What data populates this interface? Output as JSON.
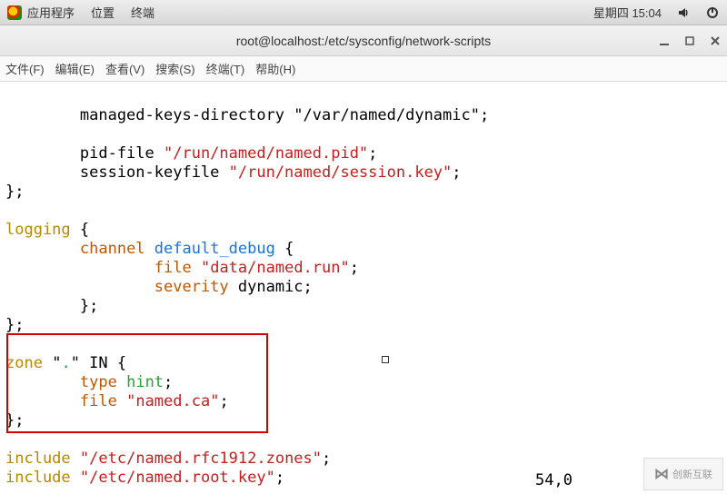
{
  "panel": {
    "apps": "应用程序",
    "places": "位置",
    "terminal_menu": "终端",
    "datetime": "星期四 15:04"
  },
  "window": {
    "title": "root@localhost:/etc/sysconfig/network-scripts"
  },
  "menubar": {
    "file": "文件(F)",
    "edit": "编辑(E)",
    "view": "查看(V)",
    "search": "搜索(S)",
    "terminal": "终端(T)",
    "help": "帮助(H)"
  },
  "code": {
    "line1": "        managed-keys-directory \"/var/named/dynamic\";",
    "blank": "",
    "line3a": "        pid-file ",
    "line3s": "\"/run/named/named.pid\"",
    "line3b": ";",
    "line4a": "        session-keyfile ",
    "line4s": "\"/run/named/session.key\"",
    "line4b": ";",
    "line5": "};",
    "log_kw": "logging",
    "log_rest": " {",
    "chan_kw": "channel",
    "chan_sp": "        ",
    "chan_id": "default_debug",
    "chan_rest": " {",
    "file_sp": "                ",
    "file_kw": "file",
    "file_s": "\"data/named.run\"",
    "file_end": ";",
    "sev_sp": "                ",
    "sev_kw": "severity",
    "sev_rest": " dynamic;",
    "close_inner": "        };",
    "close_outer": "};",
    "zone_kw": "zone",
    "zone_q1": " \"",
    "zone_dot": ".",
    "zone_q2": "\" IN {",
    "type_sp": "        ",
    "type_kw": "type",
    "type_sp2": " ",
    "type_hint": "hint",
    "type_end": ";",
    "zfile_sp": "        ",
    "zfile_kw": "file",
    "zfile_sp2": " ",
    "zfile_s": "\"named.ca\"",
    "zfile_end": ";",
    "zone_close": "};",
    "inc_kw": "include",
    "inc_sp": " ",
    "inc1_s": "\"/etc/named.rfc1912.zones\"",
    "inc1_end": ";",
    "inc2_s": "\"/etc/named.root.key\"",
    "inc2_end": ";"
  },
  "status": {
    "pos": "54,0"
  },
  "watermark": {
    "text": "创新互联"
  }
}
